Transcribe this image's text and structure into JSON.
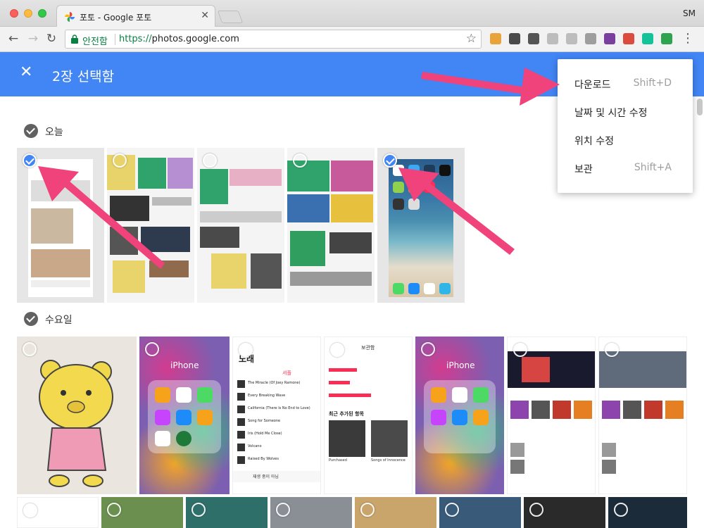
{
  "browser": {
    "tab_title": "포토 - Google 포토",
    "tab_close": "✕",
    "profile": "SM",
    "secure_label": "안전함",
    "url_scheme": "https://",
    "url_host": "photos.google.com",
    "back": "←",
    "forward": "→",
    "reload": "↻",
    "star": "☆",
    "menu": "⋮",
    "extensions": [
      {
        "name": "off-extension-icon",
        "color": "#e8a33a"
      },
      {
        "name": "evernote-icon",
        "color": "#4a4a4a"
      },
      {
        "name": "pocket-icon",
        "color": "#555555"
      },
      {
        "name": "ex-extension-icon",
        "color": "#bdbdbd"
      },
      {
        "name": "screen-extension-icon",
        "color": "#bdbdbd"
      },
      {
        "name": "readability-icon",
        "color": "#9e9e9e"
      },
      {
        "name": "onenote-icon",
        "color": "#7b3fa0"
      },
      {
        "name": "todoist-icon",
        "color": "#db4c3f"
      },
      {
        "name": "grammarly-icon",
        "color": "#15c39a"
      },
      {
        "name": "green-extension-icon",
        "color": "#2ea44f"
      }
    ]
  },
  "appbar": {
    "close": "✕",
    "selection_text": "2장 선택함"
  },
  "sections": [
    {
      "label": "오늘"
    },
    {
      "label": "수요일"
    }
  ],
  "popup_menu": {
    "items": [
      {
        "label": "다운로드",
        "shortcut": "Shift+D"
      },
      {
        "label": "날짜 및 시간 수정",
        "shortcut": ""
      },
      {
        "label": "위치 수정",
        "shortcut": ""
      },
      {
        "label": "보관",
        "shortcut": "Shift+A"
      }
    ]
  },
  "thumb_text": {
    "iphone_label": "iPhone",
    "song_title": "노래",
    "shuffle": "셔플",
    "browse_title": "보관함",
    "album_heading": "최근 추가된 항목",
    "album1": "Purchased",
    "album2": "Songs of Innocence",
    "now_playing": "재생 중이 아님",
    "songs": [
      "The Miracle (Of Joey Ramone)",
      "Every Breaking Wave",
      "California (There Is No End to Love)",
      "Song for Someone",
      "Iris (Hold Me Close)",
      "Volcano",
      "Raised By Wolves"
    ]
  }
}
